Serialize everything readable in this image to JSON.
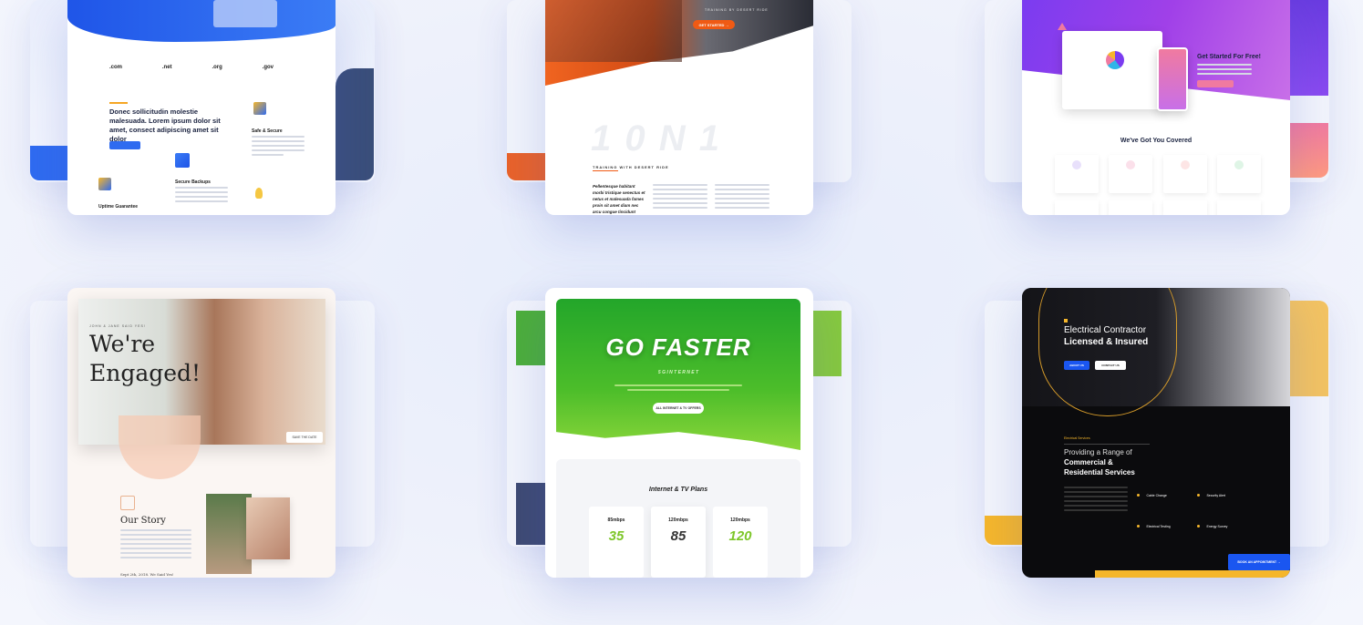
{
  "cards": {
    "hosting": {
      "domains": [
        ".com",
        ".net",
        ".org",
        ".gov"
      ],
      "eyebrow": "",
      "headline": "Donec sollicitudin molestie malesuada. Lorem ipsum dolor sit amet, consect adipiscing amet sit dolor",
      "cta": "",
      "features": [
        "Safe & Secure",
        "Secure Backups",
        "Uptime Guarantee"
      ]
    },
    "trainer": {
      "cta": "GET STARTED →",
      "tagline": "TRAINING BY DESERT RIDE",
      "big": "1 0 N 1",
      "sub": "TRAINING WITH DESERT RIDE",
      "quote": "Pellentesque habitant morbi tristique senectus et netus et malesuada fames proin sit amet diam nec arcu congue tincidunt"
    },
    "saas": {
      "headline": "Get Started For Free!",
      "section": "We've Got You Covered"
    },
    "wedding": {
      "eyebrow": "JOHN & JANE SAID YES!",
      "headline_1": "We're",
      "headline_2": "Engaged!",
      "rsvp": "SAVE THE DATE",
      "story_title": "Our Story",
      "story_date": "Sept 2th, 2018. We Said Yes!"
    },
    "isp": {
      "hero": "GO FASTER",
      "sub": "5 G   I N T E R N E T",
      "cta": "ALL INTERNET & TV OFFERS",
      "plans_title": "Internet & TV Plans",
      "plans": [
        {
          "speed": "85mbps",
          "price": "35",
          "price_color": "#7dc629"
        },
        {
          "speed": "120mbps",
          "price": "85",
          "price_color": "#333333"
        },
        {
          "speed": "120mbps",
          "price": "120",
          "price_color": "#7dc629"
        }
      ]
    },
    "electric": {
      "headline_1": "Electrical Contractor",
      "headline_2": "Licensed & Insured",
      "btn_1": "ABOUT US",
      "btn_2": "CONTACT US",
      "eyebrow": "Electrical Services",
      "providing": "Providing a Range of",
      "bold_1": "Commercial &",
      "bold_2": "Residential Services",
      "services": [
        "Cable Change",
        "Security Alert",
        "Electrical Testing",
        "Energy Survey"
      ],
      "cta": "BOOK AN APPOINTMENT →"
    }
  },
  "colors": {
    "hosting_blue": "#2f6bf0",
    "trainer_orange": "#f05a14",
    "saas_purple": "#7b3cf0",
    "wedding_peach": "#f6c9b0",
    "isp_green": "#4cbd2a",
    "electric_blue": "#1a56f0",
    "electric_gold": "#f5b62b"
  }
}
